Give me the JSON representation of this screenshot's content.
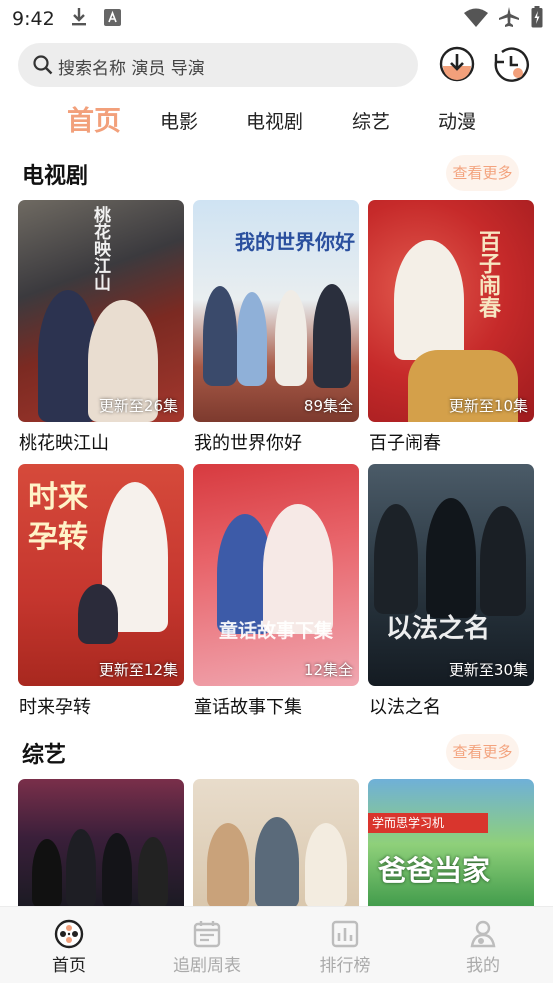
{
  "status_bar": {
    "time": "9:42"
  },
  "search": {
    "placeholder": "搜索名称 演员 导演"
  },
  "tabs": [
    {
      "label": "首页",
      "active": true
    },
    {
      "label": "电影",
      "active": false
    },
    {
      "label": "电视剧",
      "active": false
    },
    {
      "label": "综艺",
      "active": false
    },
    {
      "label": "动漫",
      "active": false
    }
  ],
  "sections": {
    "tv": {
      "title": "电视剧",
      "more_label": "查看更多",
      "items": [
        {
          "title": "桃花映江山",
          "badge": "更新至26集",
          "art": "桃花映江山"
        },
        {
          "title": "我的世界你好",
          "badge": "89集全",
          "art": "我的世界你好"
        },
        {
          "title": "百子闹春",
          "badge": "更新至10集",
          "art": "百子闹春"
        },
        {
          "title": "时来孕转",
          "badge": "更新至12集",
          "art": "时来孕转"
        },
        {
          "title": "童话故事下集",
          "badge": "12集全",
          "art": "童话故事下集"
        },
        {
          "title": "以法之名",
          "badge": "更新至30集",
          "art": "以法之名"
        }
      ]
    },
    "variety": {
      "title": "综艺",
      "more_label": "查看更多",
      "items": [
        {
          "art": ""
        },
        {
          "art": ""
        },
        {
          "art": "爸爸当家",
          "banner": "学而思学习机"
        }
      ]
    }
  },
  "bottom_nav": [
    {
      "label": "首页",
      "icon": "film-reel-icon",
      "active": true
    },
    {
      "label": "追剧周表",
      "icon": "calendar-icon",
      "active": false
    },
    {
      "label": "排行榜",
      "icon": "chart-icon",
      "active": false
    },
    {
      "label": "我的",
      "icon": "profile-icon",
      "active": false
    }
  ],
  "colors": {
    "accent": "#f2a07b",
    "more_bg": "#fdf3ec",
    "nav_inactive": "#aaaaaa"
  }
}
